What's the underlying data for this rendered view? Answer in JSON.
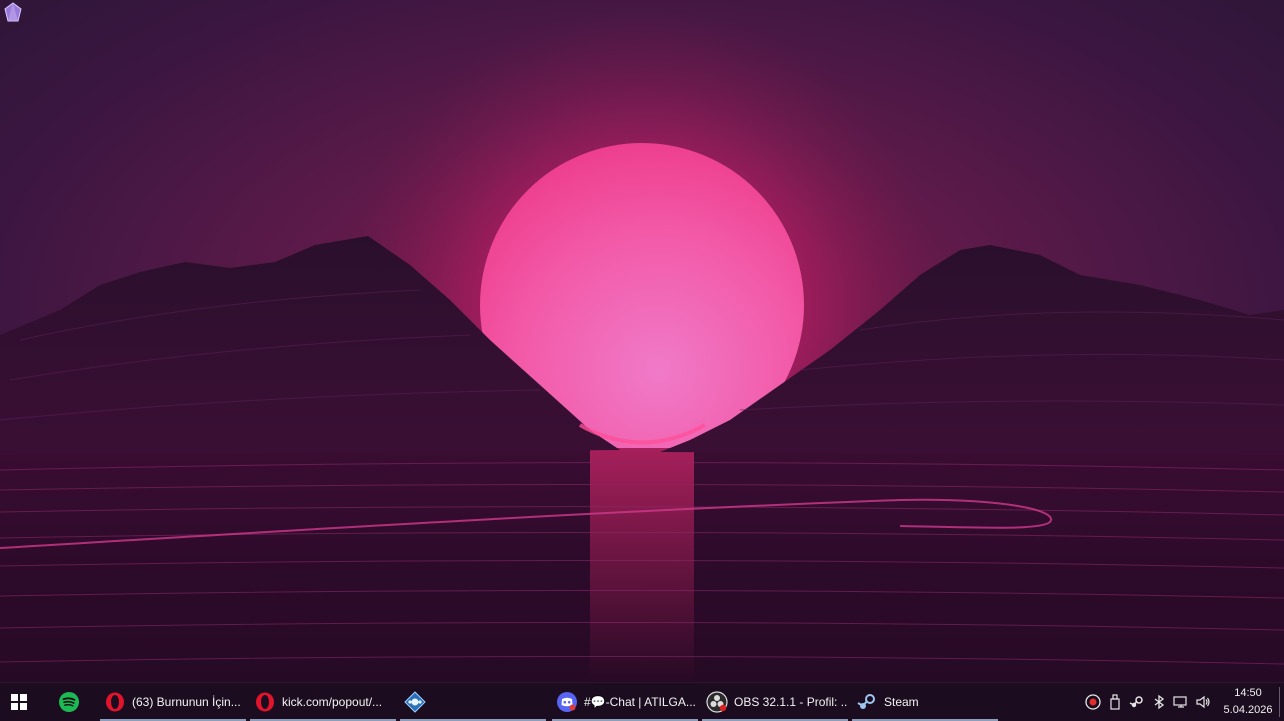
{
  "desktop": {
    "wallpaper": "synthwave-sunset",
    "icon": "purple-gem-icon"
  },
  "taskbar": {
    "start_icon": "windows-logo-icon",
    "pinned": [
      {
        "name": "spotify",
        "icon": "spotify-icon",
        "color": "#1DB954"
      }
    ],
    "apps": [
      {
        "name": "opera-1",
        "icon": "opera-icon",
        "label": "(63) Burnunun İçin..."
      },
      {
        "name": "opera-2",
        "icon": "opera-icon",
        "label": "kick.com/popout/..."
      },
      {
        "name": "app-blue",
        "icon": "diamond-app-icon",
        "label": ""
      },
      {
        "name": "discord",
        "icon": "discord-icon",
        "label": "#💬-Chat | ATILGA..."
      },
      {
        "name": "obs",
        "icon": "obs-icon",
        "label": "OBS 32.1.1 - Profil: ..."
      },
      {
        "name": "steam",
        "icon": "steam-icon",
        "label": "Steam"
      }
    ],
    "tray": [
      "red-app-tray-icon",
      "usb-tray-icon",
      "steam-tray-icon",
      "bluetooth-tray-icon",
      "network-tray-icon",
      "volume-tray-icon"
    ],
    "clock": {
      "time": "14:50",
      "date": "5.04.2026"
    }
  },
  "colors": {
    "sun": "#ff5fa8",
    "sky_top": "#2a1535",
    "taskbar_bg": "#1b0d1f",
    "opera_red": "#e0142a",
    "discord_blurple": "#5865F2"
  }
}
